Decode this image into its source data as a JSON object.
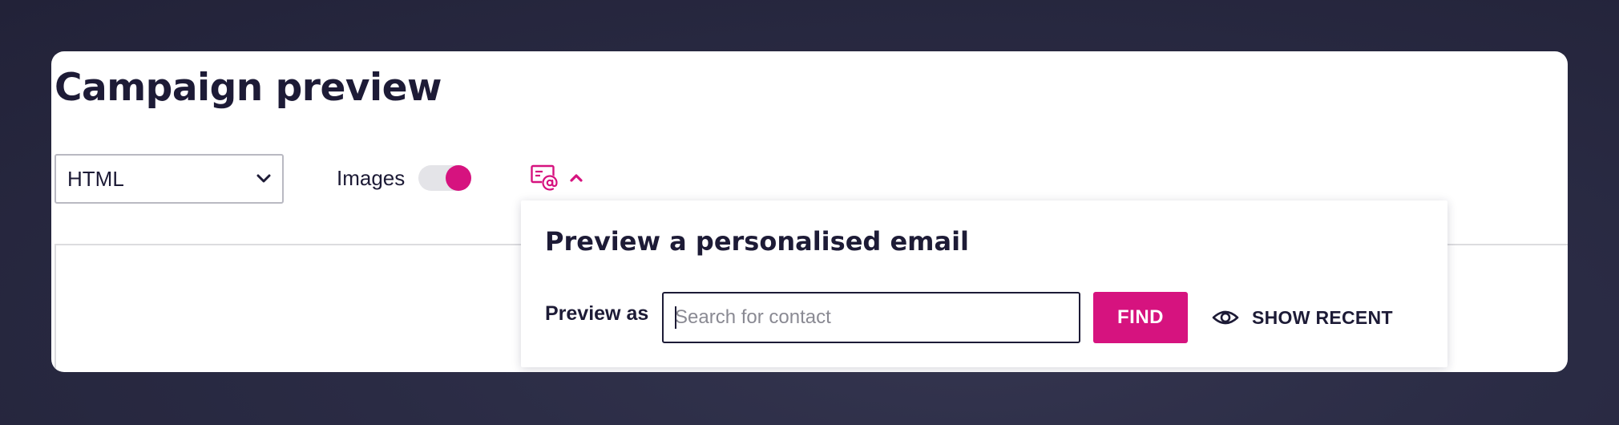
{
  "page": {
    "title": "Campaign preview"
  },
  "toolbar": {
    "format_select": {
      "value": "HTML",
      "icon": "chevron-down-icon"
    },
    "images_toggle": {
      "label": "Images",
      "on": true
    },
    "personalise_button": {
      "icon": "email-at-icon",
      "expanded_icon": "chevron-up-icon"
    }
  },
  "popover": {
    "title": "Preview a personalised email",
    "preview_as_label": "Preview as",
    "search": {
      "placeholder": "Search for contact",
      "value": ""
    },
    "find_label": "FIND",
    "show_recent_label": "SHOW RECENT",
    "show_recent_icon": "eye-icon"
  },
  "colors": {
    "accent": "#d6137f",
    "text": "#1d1b36",
    "background": "#2a2b44",
    "card": "#ffffff"
  }
}
